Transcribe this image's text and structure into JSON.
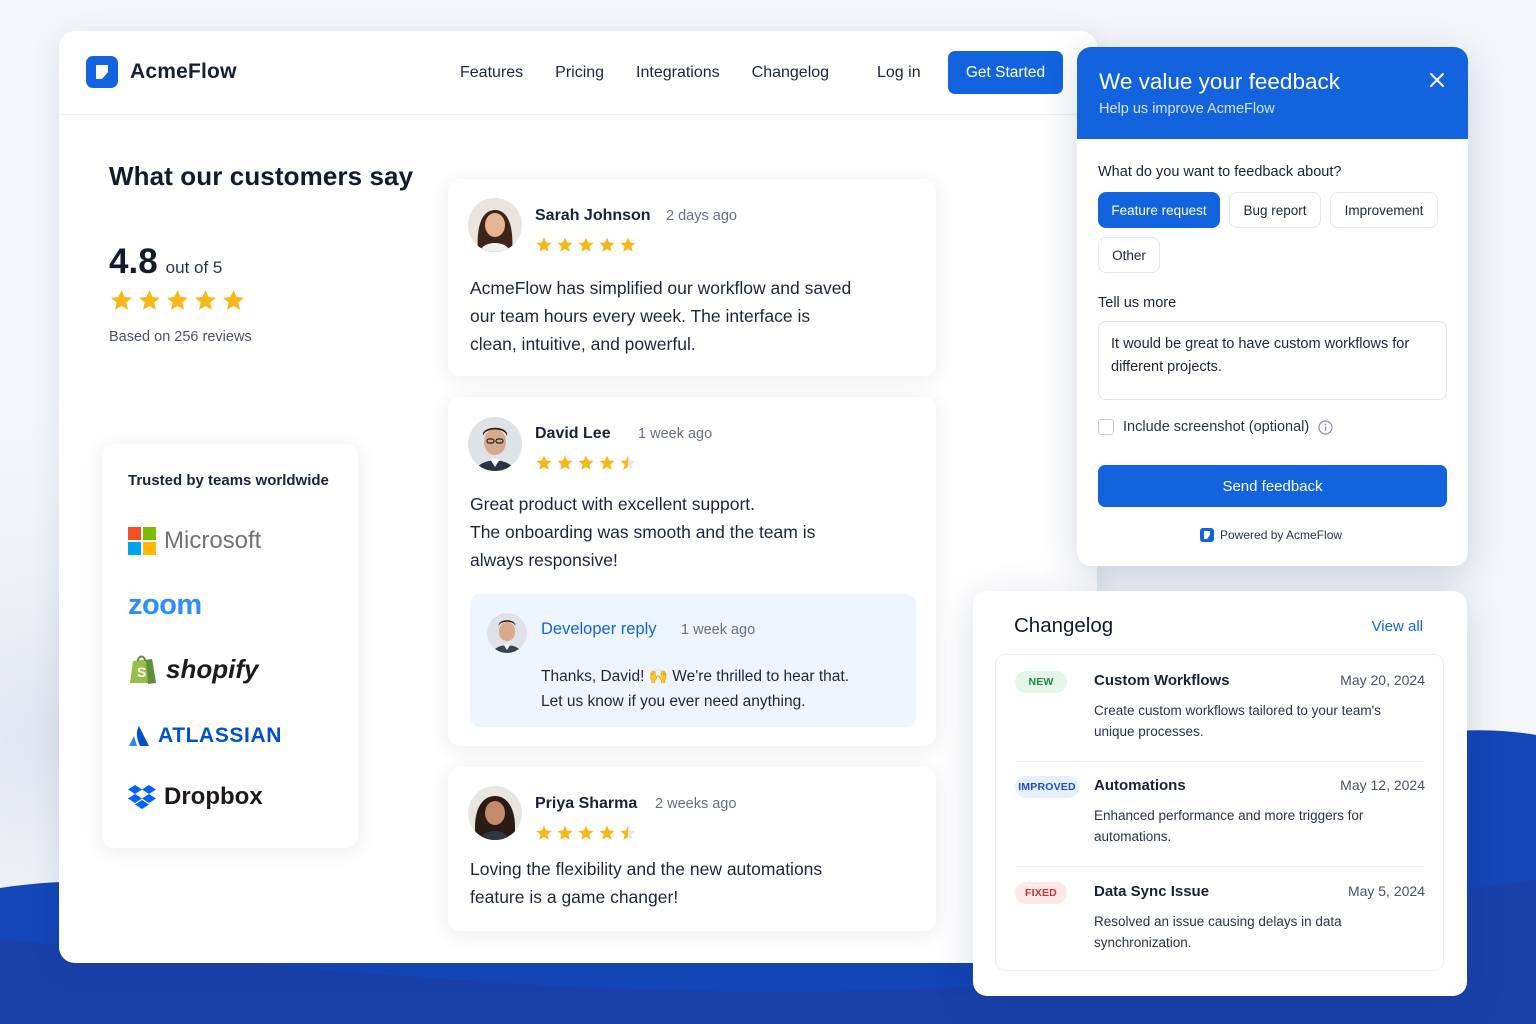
{
  "colors": {
    "accent": "#1363df",
    "star": "#f7b718",
    "bg_wave": "#1446b8"
  },
  "nav": {
    "brand": "AcmeFlow",
    "links": [
      "Features",
      "Pricing",
      "Integrations",
      "Changelog"
    ],
    "login": "Log in",
    "cta": "Get Started"
  },
  "summary": {
    "heading": "What our customers say",
    "rating": "4.8",
    "out_of": "out of 5",
    "stars": 5,
    "based_on": "Based on 256 reviews"
  },
  "trusted": {
    "heading": "Trusted by teams worldwide",
    "brands": [
      "Microsoft",
      "zoom",
      "shopify",
      "ATLASSIAN",
      "Dropbox"
    ]
  },
  "reviews": [
    {
      "name": "Sarah Johnson",
      "time": "2 days ago",
      "rating": 5,
      "text": [
        "AcmeFlow has simplified our workflow and saved",
        "our team hours every week. The interface is",
        "clean, intuitive, and powerful."
      ]
    },
    {
      "name": "David Lee",
      "time": "1 week ago",
      "rating": 4.5,
      "text": [
        "Great product with excellent support.",
        "The onboarding was smooth and the team is",
        "always responsive!"
      ],
      "reply": {
        "label": "Developer reply",
        "time": "1 week ago",
        "text": [
          "Thanks, David! 🙌 We're thrilled to hear that.",
          "Let us know if you ever need anything."
        ]
      }
    },
    {
      "name": "Priya Sharma",
      "time": "2 weeks ago",
      "rating": 4.5,
      "text": [
        "Loving the flexibility and the new automations",
        "feature is a game changer!"
      ]
    }
  ],
  "feedback": {
    "title": "We value your feedback",
    "subtitle": "Help us improve AcmeFlow",
    "topic_label": "What do you want to feedback about?",
    "topics": [
      "Feature request",
      "Bug report",
      "Improvement",
      "Other"
    ],
    "selected_topic": "Feature request",
    "more_label": "Tell us more",
    "message": "It would be great to have custom workflows for different projects.",
    "screenshot_label": "Include screenshot (optional)",
    "send": "Send feedback",
    "powered": "Powered by AcmeFlow"
  },
  "changelog": {
    "title": "Changelog",
    "view_all": "View all",
    "items": [
      {
        "badge": "NEW",
        "name": "Custom Workflows",
        "date": "May 20, 2024",
        "desc": "Create custom workflows tailored to your team's unique processes.",
        "badge_bg": "#e3f6e8",
        "badge_fg": "#1f8a45"
      },
      {
        "badge": "IMPROVED",
        "name": "Automations",
        "date": "May 12, 2024",
        "desc": "Enhanced performance and more triggers for automations.",
        "badge_bg": "#e6efff",
        "badge_fg": "#1d4fc4"
      },
      {
        "badge": "FIXED",
        "name": "Data Sync Issue",
        "date": "May 5, 2024",
        "desc": "Resolved an issue causing delays in data synchronization.",
        "badge_bg": "#fde7e7",
        "badge_fg": "#c9322f"
      }
    ]
  }
}
